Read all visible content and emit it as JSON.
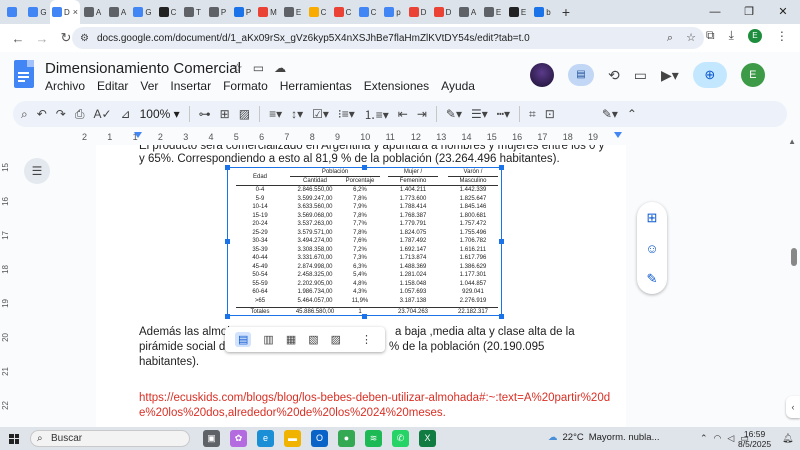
{
  "browser": {
    "tabs": [
      {
        "label": "",
        "color": "#4285f4",
        "icon": "google-icon"
      },
      {
        "label": "G",
        "color": "#4285f4",
        "icon": "google-icon"
      },
      {
        "label": "D",
        "color": "#4285f4",
        "icon": "docs-icon",
        "active": true,
        "close": "×"
      },
      {
        "label": "A",
        "color": "#5f6368",
        "icon": "app-icon"
      },
      {
        "label": "A",
        "color": "#5f6368",
        "icon": "app-icon"
      },
      {
        "label": "G",
        "color": "#4285f4",
        "icon": "google-icon"
      },
      {
        "label": "C",
        "color": "#222222",
        "icon": "app-icon"
      },
      {
        "label": "T",
        "color": "#5f6368",
        "icon": "app-icon"
      },
      {
        "label": "P",
        "color": "#5f6368",
        "icon": "app-icon"
      },
      {
        "label": "P",
        "color": "#1a73e8",
        "icon": "download-icon"
      },
      {
        "label": "M",
        "color": "#ea4335",
        "icon": "app-icon"
      },
      {
        "label": "E",
        "color": "#5f6368",
        "icon": "app-icon"
      },
      {
        "label": "C",
        "color": "#f9ab00",
        "icon": "app-icon"
      },
      {
        "label": "C",
        "color": "#ea4335",
        "icon": "gmail-icon"
      },
      {
        "label": "C",
        "color": "#4285f4",
        "icon": "google-icon"
      },
      {
        "label": "p",
        "color": "#4285f4",
        "icon": "google-icon"
      },
      {
        "label": "D",
        "color": "#ea4335",
        "icon": "app-icon"
      },
      {
        "label": "D",
        "color": "#ea4335",
        "icon": "app-icon"
      },
      {
        "label": "A",
        "color": "#5f6368",
        "icon": "app-icon"
      },
      {
        "label": "E",
        "color": "#5f6368",
        "icon": "app-icon"
      },
      {
        "label": "E",
        "color": "#222222",
        "icon": "app-icon"
      },
      {
        "label": "b",
        "color": "#1a73e8",
        "icon": "app-icon"
      }
    ],
    "new_tab": "+",
    "window_controls": {
      "minimize": "—",
      "restore": "❐",
      "close": "✕"
    },
    "url": "docs.google.com/document/d/1_aKx09rSx_gVz6kyp5X4nXSJhBe7flaHmZlKVtDY54s/edit?tab=t.0",
    "profile_initial": "E"
  },
  "docs": {
    "title": "Dimensionamiento Comercial",
    "menu": [
      "Archivo",
      "Editar",
      "Ver",
      "Insertar",
      "Formato",
      "Herramientas",
      "Extensiones",
      "Ayuda"
    ],
    "user_initial": "E",
    "zoom": "100%"
  },
  "ruler": {
    "ticks": [
      "2",
      "1",
      "1",
      "2",
      "3",
      "4",
      "5",
      "6",
      "7",
      "8",
      "9",
      "10",
      "11",
      "12",
      "13",
      "14",
      "15",
      "16",
      "17",
      "18",
      "19"
    ],
    "vertical": [
      "15",
      "16",
      "17",
      "18",
      "19",
      "20",
      "21",
      "22"
    ]
  },
  "body": {
    "p1_line1": "El producto será comercializado en Argentina y apuntará a hombres y mujeres entre los 0 y",
    "p1_line2": "y 65%. Correspondiendo a esto al 81,9 % de la población (23.264.496 habitantes).",
    "p2_line1_a": "Además las almoh",
    "p2_line1_b": "a baja ,media alta y clase alta de la",
    "p2_line2_a": "pirámide social de",
    "p2_line2_b": "% de la población (20.190.095",
    "p2_line3": "habitantes).",
    "link_line1": "https://ecuskids.com/blogs/blog/los-bebes-deben-utilizar-almohada#:~:text=A%20partir%20d",
    "link_line2": "e%20los%20dos,alrededor%20de%20los%2024%20meses."
  },
  "population_table": {
    "header_col1": "Edad",
    "header_poblacion": "Población",
    "header_cantidad": "Cantidad",
    "header_porcentaje": "Porcentaje",
    "header_mujer": "Mujer /",
    "header_femenino": "Femenino",
    "header_varon": "Varón /",
    "header_masculino": "Masculino",
    "rows": [
      [
        "0-4",
        "2.846.550,00",
        "6,2%",
        "1.404.211",
        "1.442.339"
      ],
      [
        "5-9",
        "3.599.247,00",
        "7,8%",
        "1.773.600",
        "1.825.647"
      ],
      [
        "10-14",
        "3.633.560,00",
        "7,9%",
        "1.788.414",
        "1.845.146"
      ],
      [
        "15-19",
        "3.569.068,00",
        "7,8%",
        "1.768.387",
        "1.800.681"
      ],
      [
        "20-24",
        "3.537.263,00",
        "7,7%",
        "1.779.791",
        "1.757.472"
      ],
      [
        "25-29",
        "3.579.571,00",
        "7,8%",
        "1.824.075",
        "1.755.496"
      ],
      [
        "30-34",
        "3.494.274,00",
        "7,6%",
        "1.787.492",
        "1.706.782"
      ],
      [
        "35-39",
        "3.308.358,00",
        "7,2%",
        "1.692.147",
        "1.616.211"
      ],
      [
        "40-44",
        "3.331.670,00",
        "7,3%",
        "1.713.874",
        "1.617.796"
      ],
      [
        "45-49",
        "2.874.998,00",
        "6,3%",
        "1.488.369",
        "1.386.629"
      ],
      [
        "50-54",
        "2.458.325,00",
        "5,4%",
        "1.281.024",
        "1.177.301"
      ],
      [
        "55-59",
        "2.202.905,00",
        "4,8%",
        "1.158.048",
        "1.044.857"
      ],
      [
        "60-64",
        "1.986.734,00",
        "4,3%",
        "1.057.693",
        "929.041"
      ],
      [
        ">65",
        "5.464.057,00",
        "11,9%",
        "3.187.138",
        "2.276.919"
      ]
    ],
    "total": [
      "Totales",
      "45.886.580,00",
      "1",
      "23.704.263",
      "22.182.317"
    ]
  },
  "taskbar": {
    "search_placeholder": "Buscar",
    "weather_temp": "22°C",
    "weather_desc": "Mayorm. nubla...",
    "time": "16:59",
    "date": "8/5/2025",
    "apps": [
      {
        "icon": "task-view-icon",
        "color": "#5f6368",
        "glyph": "▣"
      },
      {
        "icon": "copilot-icon",
        "color": "#b46be0",
        "glyph": "✿"
      },
      {
        "icon": "edge-icon",
        "color": "#1a8fd6",
        "glyph": "e"
      },
      {
        "icon": "file-explorer-icon",
        "color": "#f0b400",
        "glyph": "▬"
      },
      {
        "icon": "outlook-icon",
        "color": "#0a64c8",
        "glyph": "O"
      },
      {
        "icon": "chrome-icon",
        "color": "#34a853",
        "glyph": "●"
      },
      {
        "icon": "spotify-icon",
        "color": "#1db954",
        "glyph": "≋"
      },
      {
        "icon": "whatsapp-icon",
        "color": "#25d366",
        "glyph": "✆"
      },
      {
        "icon": "excel-icon",
        "color": "#107c41",
        "glyph": "X"
      }
    ]
  }
}
